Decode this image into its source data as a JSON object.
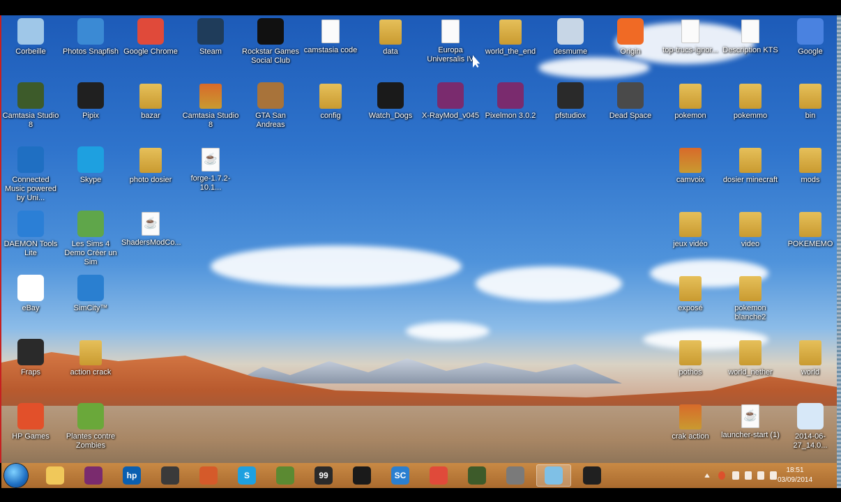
{
  "desktop": {
    "icons": [
      {
        "label": "Corbeille",
        "icon": "recycle-bin-icon",
        "color": "#9fc7e8"
      },
      {
        "label": "Photos Snapfish",
        "icon": "camera-icon",
        "color": "#3b8ad4"
      },
      {
        "label": "Google Chrome",
        "icon": "chrome-icon",
        "color": "#e04a3a"
      },
      {
        "label": "Steam",
        "icon": "steam-icon",
        "color": "#1f3c5a"
      },
      {
        "label": "Rockstar Games Social Club",
        "icon": "rockstar-icon",
        "color": "#111111"
      },
      {
        "label": "camstasia code",
        "icon": "document-icon",
        "color": "#ffffff"
      },
      {
        "label": "data",
        "icon": "folder-icon",
        "color": "#e6c05a"
      },
      {
        "label": "Europa Universalis IV",
        "icon": "document-icon",
        "color": "#ffffff"
      },
      {
        "label": "world_the_end",
        "icon": "folder-icon",
        "color": "#e6c05a"
      },
      {
        "label": "desmume",
        "icon": "gear-icon",
        "color": "#c7d6e6"
      },
      {
        "label": "Origin",
        "icon": "origin-icon",
        "color": "#f06a25"
      },
      {
        "label": "top-trucs-ignor...",
        "icon": "document-icon",
        "color": "#7fc0e6"
      },
      {
        "label": "Description KTS",
        "icon": "document-icon",
        "color": "#ffffff"
      },
      {
        "label": "Google",
        "icon": "google-icon",
        "color": "#4a82e0"
      },
      {
        "label": "Camtasia Studio 8",
        "icon": "camtasia-icon",
        "color": "#3d5b2a"
      },
      {
        "label": "Pipix",
        "icon": "pipix-icon",
        "color": "#202020"
      },
      {
        "label": "bazar",
        "icon": "folder-icon",
        "color": "#e6c05a"
      },
      {
        "label": "Camtasia Studio 8",
        "icon": "folder-icon",
        "color": "#d86a2a"
      },
      {
        "label": "GTA San Andreas",
        "icon": "gta-icon",
        "color": "#a8733a"
      },
      {
        "label": "config",
        "icon": "folder-icon",
        "color": "#e6c05a"
      },
      {
        "label": "Watch_Dogs",
        "icon": "watchdogs-icon",
        "color": "#1a1a1a"
      },
      {
        "label": "X-RayMod_v045",
        "icon": "winrar-icon",
        "color": "#7a2b6e"
      },
      {
        "label": "Pixelmon 3.0.2",
        "icon": "winrar-icon",
        "color": "#7a2b6e"
      },
      {
        "label": "pfstudiox",
        "icon": "studio-icon",
        "color": "#2a2a2a"
      },
      {
        "label": "Dead Space",
        "icon": "deadspace-icon",
        "color": "#4a4a4a"
      },
      {
        "label": "pokemon",
        "icon": "folder-icon",
        "color": "#e6c05a"
      },
      {
        "label": "pokemmo",
        "icon": "folder-icon",
        "color": "#e6c05a"
      },
      {
        "label": "bin",
        "icon": "folder-icon",
        "color": "#e6c05a"
      },
      {
        "label": "Connected Music powered by Uni...",
        "icon": "equalizer-icon",
        "color": "#1f6fc2"
      },
      {
        "label": "Skype",
        "icon": "skype-icon",
        "color": "#1ea0e0"
      },
      {
        "label": "photo dosier",
        "icon": "folder-icon",
        "color": "#e6c05a"
      },
      {
        "label": "forge-1.7.2-10.1...",
        "icon": "java-icon",
        "color": "#ffffff"
      },
      {
        "label": "camvoix",
        "icon": "folder-icon",
        "color": "#d86a2a"
      },
      {
        "label": "dosier minecraft",
        "icon": "folder-icon",
        "color": "#e6c05a"
      },
      {
        "label": "mods",
        "icon": "folder-icon",
        "color": "#e6c05a"
      },
      {
        "label": "DAEMON Tools Lite",
        "icon": "daemon-icon",
        "color": "#2b7fd6"
      },
      {
        "label": "Les Sims 4 Demo Créer un Sim",
        "icon": "sims-icon",
        "color": "#5fa64a"
      },
      {
        "label": "ShadersModCo...",
        "icon": "java-icon",
        "color": "#ffffff"
      },
      {
        "label": "jeux vidéo",
        "icon": "folder-icon",
        "color": "#e6c05a"
      },
      {
        "label": "video",
        "icon": "folder-icon",
        "color": "#e6c05a"
      },
      {
        "label": "POKEMEMO",
        "icon": "folder-icon",
        "color": "#e6c05a"
      },
      {
        "label": "eBay",
        "icon": "ebay-icon",
        "color": "#ffffff"
      },
      {
        "label": "SimCity™",
        "icon": "simcity-icon",
        "color": "#2a7fd0"
      },
      {
        "label": "exposé",
        "icon": "folder-icon",
        "color": "#e6c05a"
      },
      {
        "label": "pokemon blanche2",
        "icon": "folder-icon",
        "color": "#e6c05a"
      },
      {
        "label": "Fraps",
        "icon": "fraps-icon",
        "color": "#2a2a2a"
      },
      {
        "label": "action crack",
        "icon": "folder-icon",
        "color": "#e6c05a"
      },
      {
        "label": "pothos",
        "icon": "folder-icon",
        "color": "#e6c05a"
      },
      {
        "label": "world_nether",
        "icon": "folder-icon",
        "color": "#e6c05a"
      },
      {
        "label": "world",
        "icon": "folder-icon",
        "color": "#e6c05a"
      },
      {
        "label": "HP Games",
        "icon": "hp-games-icon",
        "color": "#e2502a"
      },
      {
        "label": "Plantes contre Zombies",
        "icon": "pvz-icon",
        "color": "#6aa83a"
      },
      {
        "label": "crak action",
        "icon": "folder-icon",
        "color": "#d86a2a"
      },
      {
        "label": "launcher-start (1)",
        "icon": "java-icon",
        "color": "#ffffff"
      },
      {
        "label": "2014-06-27_14.0...",
        "icon": "image-icon",
        "color": "#d7e8f8"
      }
    ]
  },
  "taskbar": {
    "items": [
      {
        "icon": "file-explorer-icon",
        "color": "#f0c85a",
        "text": ""
      },
      {
        "icon": "media-app-icon",
        "color": "#7a2b6e",
        "text": ""
      },
      {
        "icon": "hp-icon",
        "color": "#0a5fb0",
        "text": "hp"
      },
      {
        "icon": "cursor-app-icon",
        "color": "#3a3a3a",
        "text": ""
      },
      {
        "icon": "office-icon",
        "color": "#d55a2a",
        "text": ""
      },
      {
        "icon": "skype-icon",
        "color": "#1ea0e0",
        "text": "S"
      },
      {
        "icon": "minecraft-icon",
        "color": "#5b8a32",
        "text": ""
      },
      {
        "icon": "fraps-icon",
        "color": "#2a2a2a",
        "text": "99"
      },
      {
        "icon": "media-player-icon",
        "color": "#1a1a1a",
        "text": ""
      },
      {
        "icon": "simcity-icon",
        "color": "#2a7fd0",
        "text": "SC"
      },
      {
        "icon": "chrome-icon",
        "color": "#e04a3a",
        "text": ""
      },
      {
        "icon": "camtasia-icon",
        "color": "#3d5b2a",
        "text": ""
      },
      {
        "icon": "recorder-icon",
        "color": "#7a7a7a",
        "text": ""
      },
      {
        "icon": "notepad-icon",
        "color": "#7fc0e6",
        "text": ""
      },
      {
        "icon": "unknown-app-icon",
        "color": "#202020",
        "text": ""
      }
    ],
    "clock": {
      "time": "18:51",
      "date": "03/09/2014"
    }
  }
}
